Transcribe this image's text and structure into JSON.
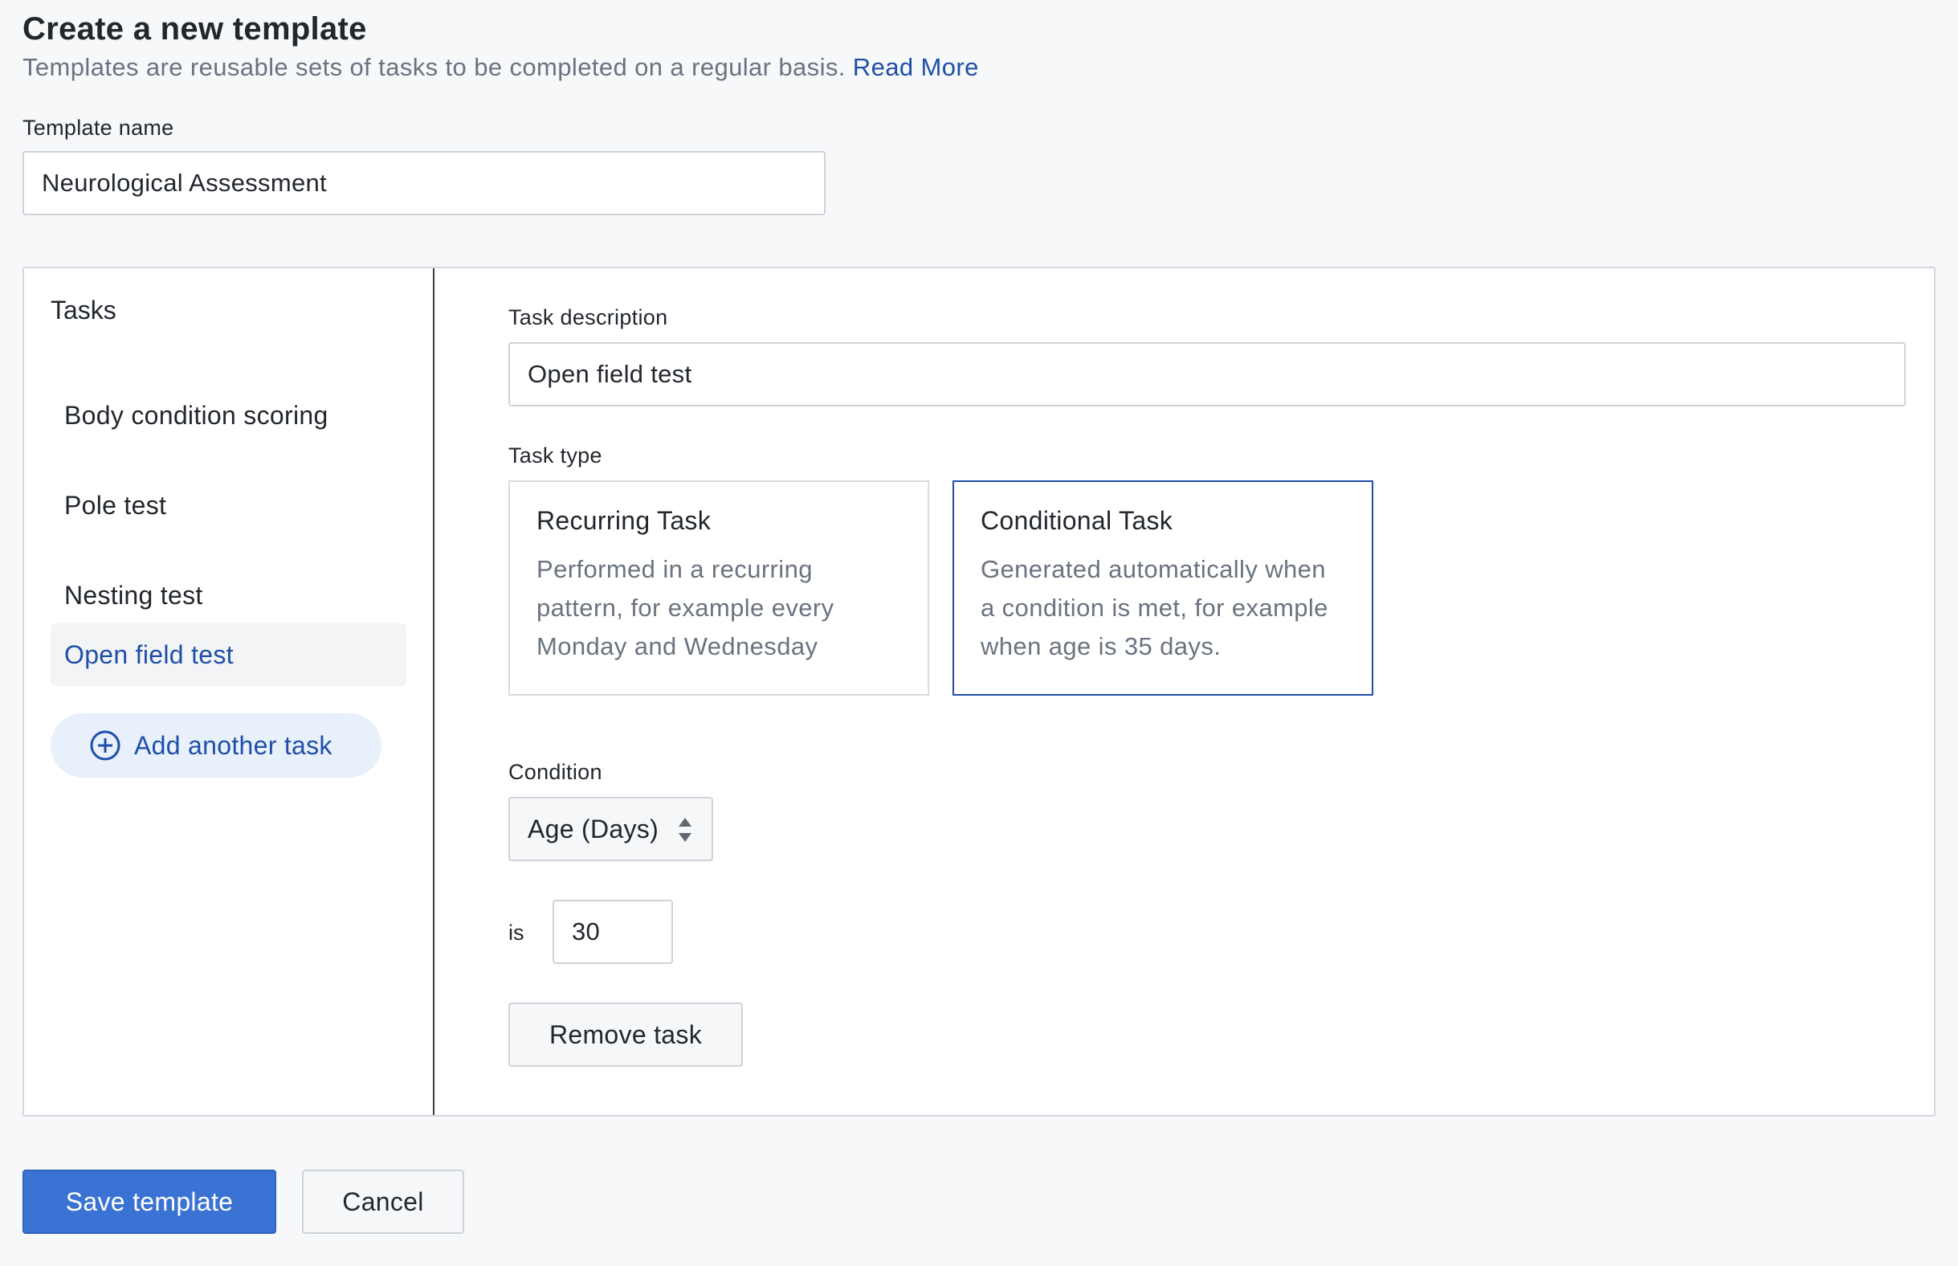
{
  "header": {
    "title": "Create a new template",
    "subtitle": "Templates are reusable sets of tasks to be completed on a regular basis.",
    "read_more": "Read More"
  },
  "template": {
    "name_label": "Template name",
    "name_value": "Neurological Assessment"
  },
  "sidebar": {
    "heading": "Tasks",
    "items": [
      {
        "label": "Body condition scoring",
        "active": false
      },
      {
        "label": "Pole test",
        "active": false
      },
      {
        "label": "Nesting test",
        "active": false
      },
      {
        "label": "Open field test",
        "active": true
      }
    ],
    "add_label": "Add another task"
  },
  "task": {
    "description_label": "Task description",
    "description_value": "Open field test",
    "type_label": "Task type",
    "types": [
      {
        "title": "Recurring Task",
        "description": "Performed in a recurring pattern, for example every Monday and Wednesday",
        "selected": false
      },
      {
        "title": "Conditional Task",
        "description": "Generated automatically when a condition is met, for example when age is 35 days.",
        "selected": true
      }
    ],
    "condition_label": "Condition",
    "condition_value": "Age (Days)",
    "is_label": "is",
    "is_value": "30",
    "remove_label": "Remove task"
  },
  "footer": {
    "save_label": "Save template",
    "cancel_label": "Cancel"
  },
  "colors": {
    "accent": "#1f4fa8",
    "primary_button": "#3a73d4",
    "background": "#f7f8fa"
  }
}
